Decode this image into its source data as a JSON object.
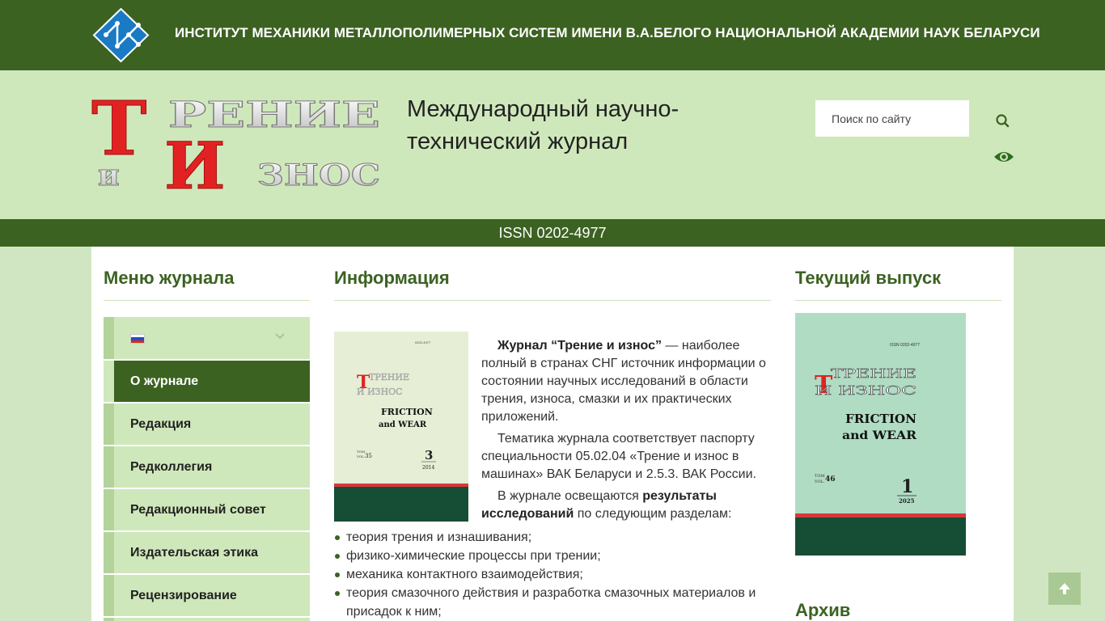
{
  "header": {
    "institute_title": "ИНСТИТУТ МЕХАНИКИ МЕТАЛЛОПОЛИМЕРНЫХ СИСТЕМ ИМЕНИ В.А.БЕЛОГО НАЦИОНАЛЬНОЙ АКАДЕМИИ НАУК БЕЛАРУСИ",
    "journal_logo_line1": "Трение",
    "journal_logo_line2": "и Износ",
    "subtitle": "Международный научно-технический журнал",
    "search_placeholder": "Поиск по сайту",
    "issn": "ISSN 0202-4977"
  },
  "sidebar": {
    "heading": "Меню журнала",
    "items": [
      {
        "label": "О журнале",
        "active": true
      },
      {
        "label": "Редакция"
      },
      {
        "label": "Редколлегия"
      },
      {
        "label": "Редакционный совет"
      },
      {
        "label": "Издательская этика"
      },
      {
        "label": "Рецензирование"
      }
    ]
  },
  "main": {
    "heading": "Информация",
    "p1_bold": "Журнал “Трение и износ”",
    "p1_rest": " — наиболее полный в странах СНГ источник информации о состоянии научных исследований в области трения, износа, смазки и их практических приложений.",
    "p2": "Тематика журнала соответствует паспорту специальности 05.02.04 «Трение и износ в машинах» ВАК Беларуси и 2.5.3. ВАК России.",
    "p3_start": "В журнале освещаются ",
    "p3_bold": "результаты исследований",
    "p3_end": " по следующим разделам:",
    "bullets": [
      "теория трения и изнашивания;",
      "физико-химические процессы при трении;",
      "механика контактного взаимодействия;",
      "теория смазочного действия и разработка смазочных материалов и присадок к ним;"
    ],
    "cover_small": {
      "issn": "0202-4977",
      "title_ru_1": "ТРЕНИЕ",
      "title_ru_2": "И ИЗНОС",
      "title_en_1": "FRICTION",
      "title_en_2": "and WEAR",
      "vol_label_1": "TOM",
      "vol_label_2": "VOL.",
      "volume": "35",
      "number": "3",
      "year": "2014"
    }
  },
  "right": {
    "current_heading": "Текущий выпуск",
    "cover": {
      "issn": "ISSN 0202-4977",
      "title_ru_1": "ТРЕНИЕ",
      "title_ru_2": "И ИЗНОС",
      "title_en_1": "FRICTION",
      "title_en_2": "and WEAR",
      "vol_label_1": "TOM",
      "vol_label_2": "VOL.",
      "volume": "46",
      "number": "1",
      "year": "2025"
    },
    "archive_heading": "Архив"
  },
  "colors": {
    "dark_green": "#3c6222",
    "light_green": "#cfe8bb",
    "accent_red": "#e02424",
    "cover_small_bg": "#e6eed6",
    "cover_big_bg": "#b0dcc4",
    "cover_footer": "#164d35"
  },
  "icons": [
    "institute-logo",
    "search-icon",
    "eye-icon",
    "flag-ru-icon",
    "chevron-down-icon",
    "arrow-up-icon"
  ]
}
